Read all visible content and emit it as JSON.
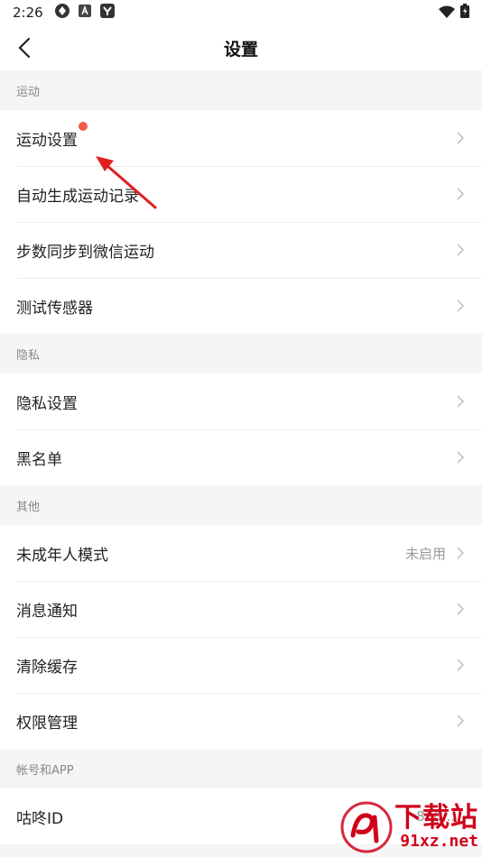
{
  "status_bar": {
    "time": "2:26"
  },
  "nav": {
    "title": "设置"
  },
  "sections": [
    {
      "header": "运动",
      "items": [
        {
          "label": "运动设置",
          "badge": true
        },
        {
          "label": "自动生成运动记录"
        },
        {
          "label": "步数同步到微信运动"
        },
        {
          "label": "测试传感器"
        }
      ]
    },
    {
      "header": "隐私",
      "items": [
        {
          "label": "隐私设置"
        },
        {
          "label": "黑名单"
        }
      ]
    },
    {
      "header": "其他",
      "items": [
        {
          "label": "未成年人模式",
          "value": "未启用"
        },
        {
          "label": "消息通知"
        },
        {
          "label": "清除缓存"
        },
        {
          "label": "权限管理"
        }
      ]
    },
    {
      "header": "帐号和APP",
      "items": [
        {
          "label": "咕咚ID",
          "value": "830..."
        }
      ]
    }
  ],
  "watermark": {
    "text": "下载站",
    "url": "91xz.net"
  },
  "colors": {
    "badge": "#f15a4a",
    "annotation_arrow": "#e02020",
    "watermark": "#d0021b"
  }
}
